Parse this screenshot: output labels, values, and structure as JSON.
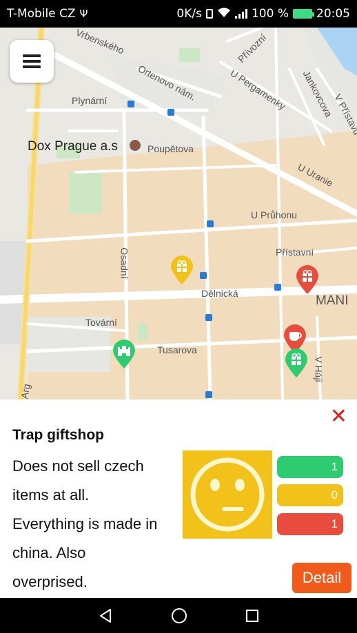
{
  "status_bar": {
    "carrier": "T-Mobile CZ",
    "usb_glyph": "Ψ",
    "speed": "0K/s",
    "battery_pct": "100 %",
    "time": "20:05"
  },
  "map": {
    "labels": {
      "vrbenskeho": "Vrbenského",
      "ortenovo": "Ortenovo nám.",
      "privozni": "Přívozní",
      "u_pergamenky": "U Pergamenky",
      "jankovcova": "Jankovcova",
      "v_pristavu": "V Přístavu",
      "plynarni": "Plynární",
      "dox": "Dox Prague a.s",
      "poupetova": "Poupětova",
      "u_uranie": "U Uranie",
      "u_pruhonu": "U Průhonu",
      "pristavni": "Přístavní",
      "osadni": "Osadní",
      "delnicka": "Dělnická",
      "manin": "MANI",
      "tovarni": "Tovární",
      "tusarova": "Tusarova",
      "v_haji": "V Háji",
      "arg": "Arg"
    },
    "markers": {
      "yellow": "#f2c21a",
      "red": "#e74c3c",
      "green": "#2ecc71"
    }
  },
  "panel": {
    "close_glyph": "✕",
    "title": "Trap giftshop",
    "description_lines": [
      "Does not sell czech",
      "items at all.",
      "Everything is made in",
      "china. Also",
      "overprised."
    ],
    "votes": {
      "positive": "1",
      "neutral": "0",
      "negative": "1"
    },
    "detail_label": "Detail"
  },
  "nav": {
    "back": "back-icon",
    "home": "home-icon",
    "recents": "recents-icon"
  }
}
